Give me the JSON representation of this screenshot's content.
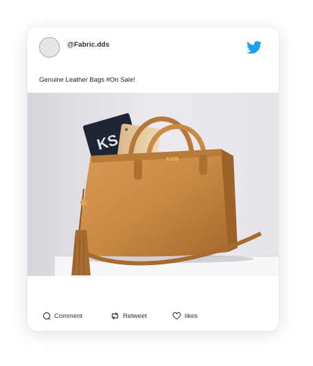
{
  "post": {
    "handle": "@Fabric.dds",
    "caption": "Genuine Leather Bags #On Sale!",
    "image_monogram": "KSM",
    "notebook_letters": "KS"
  },
  "actions": {
    "comment_label": "Comment",
    "retweet_label": "Retweet",
    "likes_label": "likes"
  },
  "icons": {
    "brand": "twitter-bird-icon",
    "comment": "comment-icon",
    "retweet": "retweet-icon",
    "like": "heart-icon"
  },
  "colors": {
    "twitter_blue": "#1DA1F2",
    "bag_leather": "#c98a45"
  }
}
